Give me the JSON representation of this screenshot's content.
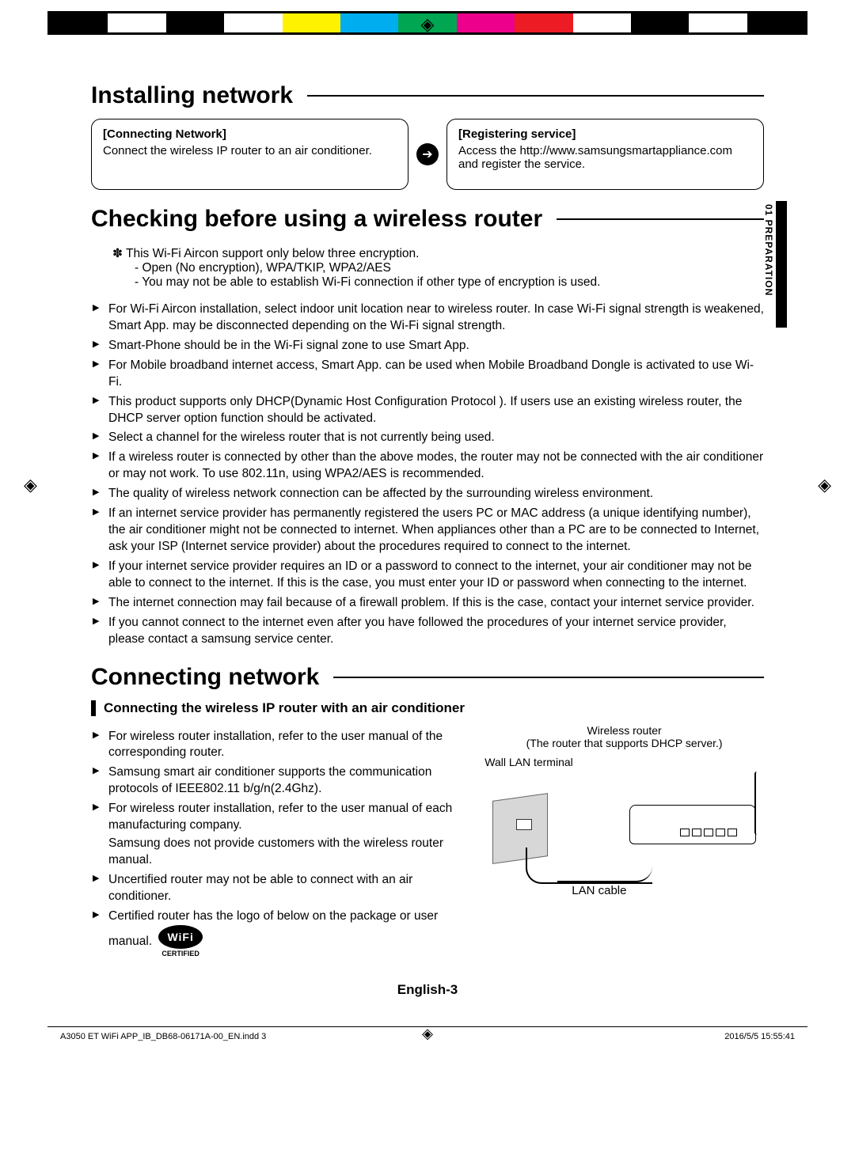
{
  "color_bar": [
    "#000000",
    "#ffffff",
    "#000000",
    "#ffffff",
    "#fff200",
    "#00aeef",
    "#00a651",
    "#ec008c",
    "#ed1c24",
    "#ffffff",
    "#000000",
    "#ffffff",
    "#000000"
  ],
  "titles": {
    "installing": "Installing network",
    "checking": "Checking before using a wireless router",
    "connecting": "Connecting network",
    "subhead": "Connecting the wireless IP router with an air conditioner"
  },
  "boxes": {
    "left_title": "[Connecting Network]",
    "left_body": "Connect the wireless IP router to an air conditioner.",
    "right_title": "[Registering service]",
    "right_body": "Access the  http://www.samsungsmartappliance.com and register the service."
  },
  "side_tab": "01  PREPARATION",
  "encryption_note": {
    "star": "✽    This Wi-Fi Aircon support only below three encryption.",
    "dash1": "-  Open (No encryption), WPA/TKIP, WPA2/AES",
    "dash2": "-  You may not be able to establish Wi-Fi connection if other type of encryption is used."
  },
  "check_bullets": [
    "For Wi-Fi Aircon installation, select indoor unit location near to wireless router. In case Wi-Fi signal strength is weakened, Smart App. may be disconnected depending on the Wi-Fi signal strength.",
    "Smart-Phone should be in the Wi-Fi signal zone to use Smart App.",
    "For Mobile broadband internet access, Smart App. can be used when Mobile Broadband Dongle is activated to use Wi-Fi.",
    "This product supports only DHCP(Dynamic Host Configuration Protocol ). If users use an existing wireless router, the DHCP server option function should be activated.",
    "Select a channel for the wireless router that is not currently being used.",
    "If a wireless router is connected by other than the above modes, the router may not be connected with the air conditioner or may not work. To use 802.11n, using WPA2/AES is recommended.",
    "The quality of wireless network connection can be affected by the surrounding wireless environment.",
    "If an internet service provider has permanently registered the users PC or MAC address (a unique identifying number), the air conditioner might not be connected to internet. When appliances other than a PC are to be connected to Internet, ask your ISP (Internet service provider) about the procedures required to connect to the internet.",
    "If your internet service provider requires an ID or a password to connect to the internet, your air conditioner may not be able to connect to the internet. If this is the case, you must enter your ID or password when connecting to the internet.",
    "The internet connection may fail because of a firewall problem. If this is the case, contact your internet service provider.",
    "If you cannot connect to the internet even after you have followed the procedures of your internet service provider, please contact a samsung service center."
  ],
  "connect_bullets": [
    {
      "main": "For wireless router installation, refer to the user manual of the corresponding router."
    },
    {
      "main": "Samsung smart air conditioner supports the communication protocols of IEEE802.11 b/g/n(2.4Ghz)."
    },
    {
      "main": "For wireless router installation, refer to the user manual of each manufacturing company.",
      "cont": "Samsung does not provide customers with the wireless router manual."
    },
    {
      "main": "Uncertified router may not be able to connect with an air conditioner."
    },
    {
      "main": "Certified router has the logo of below on the package or user manual.",
      "logo": true
    }
  ],
  "diagram": {
    "router_label_1": "Wireless router",
    "router_label_2": "(The router that supports DHCP server.)",
    "wall_label": "Wall LAN terminal",
    "cable_label": "LAN cable"
  },
  "wifi_logo": {
    "text": "WiFi",
    "sub": "CERTIFIED"
  },
  "footer": {
    "page": "English-3",
    "indd": "A3050 ET WiFi APP_IB_DB68-06171A-00_EN.indd   3",
    "timestamp": "2016/5/5   15:55:41"
  }
}
